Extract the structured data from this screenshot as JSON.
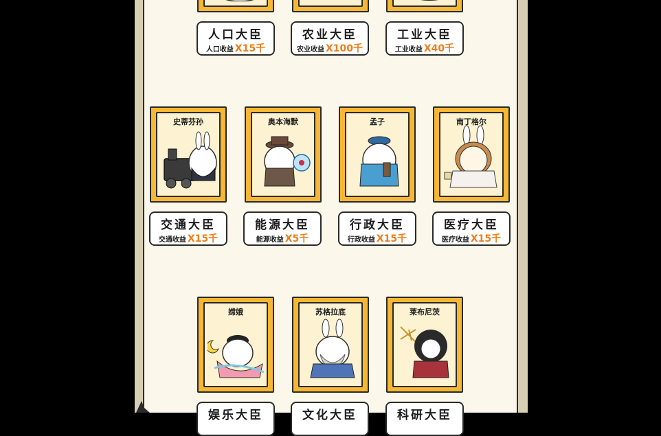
{
  "top_labels": [
    {
      "title": "人口大臣",
      "income_label": "人口收益",
      "income_value": "X15千"
    },
    {
      "title": "农业大臣",
      "income_label": "农业收益",
      "income_value": "X100千"
    },
    {
      "title": "工业大臣",
      "income_label": "工业收益",
      "income_value": "X40千"
    }
  ],
  "middle_cards": [
    {
      "name": "史蒂芬孙",
      "title": "交通大臣",
      "income_label": "交通收益",
      "income_value": "X15千"
    },
    {
      "name": "奥本海默",
      "title": "能源大臣",
      "income_label": "能源收益",
      "income_value": "X5千"
    },
    {
      "name": "孟子",
      "title": "行政大臣",
      "income_label": "行政收益",
      "income_value": "X15千"
    },
    {
      "name": "南丁格尔",
      "title": "医疗大臣",
      "income_label": "医疗收益",
      "income_value": "X15千"
    }
  ],
  "bottom_cards": [
    {
      "name": "嫦娥",
      "title": "娱乐大臣"
    },
    {
      "name": "苏格拉底",
      "title": "文化大臣"
    },
    {
      "name": "莱布尼茨",
      "title": "科研大臣"
    }
  ],
  "colors": {
    "card_frame": "#f7b733",
    "card_inner": "#fdf3d2",
    "panel": "#fbf7ea",
    "income_value": "#f07d18"
  }
}
